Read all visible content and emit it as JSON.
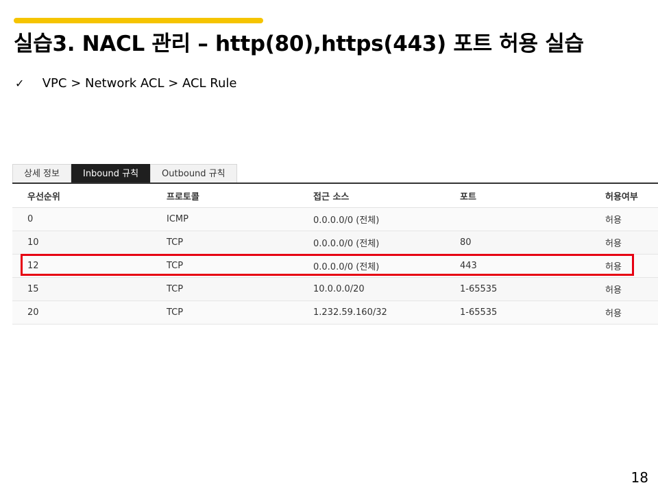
{
  "slide": {
    "title": "실습3. NACL 관리 – http(80),https(443) 포트 허용 실습",
    "bullet_icon": "check-mark-icon",
    "bullet_symbol": "✓",
    "bullet_text": "VPC > Network ACL > ACL Rule",
    "page_number": "18",
    "accent_color": "#f5c400",
    "highlight_color": "#e60012"
  },
  "tabs": [
    {
      "label": "상세 정보",
      "active": false
    },
    {
      "label": "Inbound 규칙",
      "active": true
    },
    {
      "label": "Outbound 규칙",
      "active": false
    }
  ],
  "table": {
    "headers": [
      "우선순위",
      "프로토콜",
      "접근 소스",
      "포트",
      "허용여부"
    ],
    "rows": [
      [
        "0",
        "ICMP",
        "0.0.0.0/0 (전체)",
        "",
        "허용"
      ],
      [
        "10",
        "TCP",
        "0.0.0.0/0 (전체)",
        "80",
        "허용"
      ],
      [
        "12",
        "TCP",
        "0.0.0.0/0 (전체)",
        "443",
        "허용"
      ],
      [
        "15",
        "TCP",
        "10.0.0.0/20",
        "1-65535",
        "허용"
      ],
      [
        "20",
        "TCP",
        "1.232.59.160/32",
        "1-65535",
        "허용"
      ]
    ],
    "highlighted_row": 2
  }
}
